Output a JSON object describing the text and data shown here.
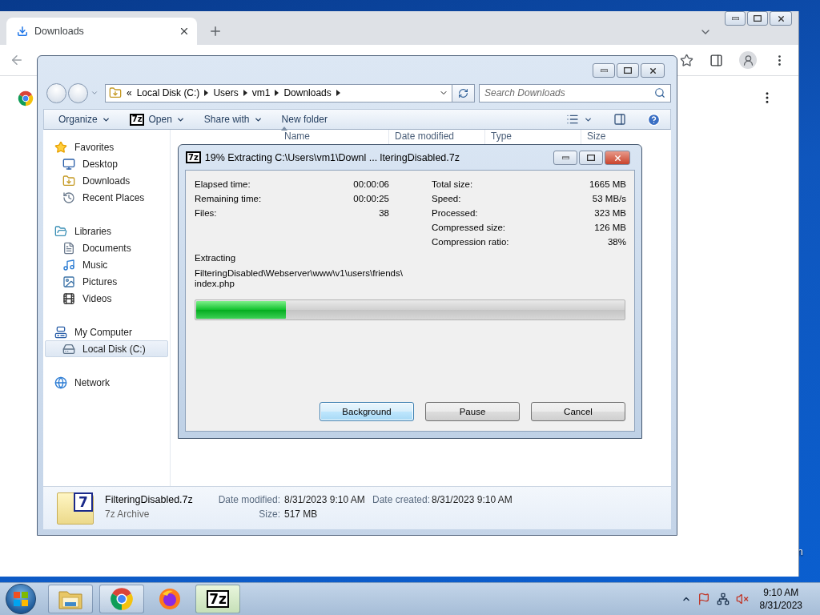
{
  "desktop": {
    "icon_label_fragment": "n"
  },
  "browser": {
    "tabs": [
      {
        "label": "Downloads",
        "selected": true
      }
    ]
  },
  "explorer": {
    "address": {
      "overflow": "«",
      "path": [
        "Local Disk (C:)",
        "Users",
        "vm1",
        "Downloads"
      ]
    },
    "search": {
      "placeholder": "Search Downloads"
    },
    "commands": [
      {
        "label": "Organize",
        "kind": "menu"
      },
      {
        "label": "Open",
        "kind": "app-menu",
        "badge": "7z"
      },
      {
        "label": "Share with",
        "kind": "menu"
      },
      {
        "label": "New folder",
        "kind": "plain"
      }
    ],
    "columns": [
      {
        "label": "Name",
        "sorted": true
      },
      {
        "label": "Date modified",
        "sorted": false
      },
      {
        "label": "Type",
        "sorted": false
      },
      {
        "label": "Size",
        "sorted": false
      }
    ],
    "navigation": [
      {
        "label": "Favorites",
        "kind": "favorites",
        "selected": false,
        "children": [
          {
            "label": "Desktop",
            "kind": "desktop",
            "selected": false
          },
          {
            "label": "Downloads",
            "kind": "downloads",
            "selected": false
          },
          {
            "label": "Recent Places",
            "kind": "recent",
            "selected": false
          }
        ]
      },
      {
        "label": "Libraries",
        "kind": "libraries",
        "selected": false,
        "children": [
          {
            "label": "Documents",
            "kind": "documents",
            "selected": false
          },
          {
            "label": "Music",
            "kind": "music",
            "selected": false
          },
          {
            "label": "Pictures",
            "kind": "pictures",
            "selected": false
          },
          {
            "label": "Videos",
            "kind": "videos",
            "selected": false
          }
        ]
      },
      {
        "label": "My Computer",
        "kind": "computer",
        "selected": false,
        "children": [
          {
            "label": "Local Disk (C:)",
            "kind": "drive",
            "selected": true
          }
        ]
      },
      {
        "label": "Network",
        "kind": "network",
        "selected": false
      }
    ],
    "details": {
      "badge": "7",
      "name": "FilteringDisabled.7z",
      "type": "7z Archive",
      "fields": [
        {
          "label": "Date modified:",
          "value": "8/31/2023 9:10 AM"
        },
        {
          "label": "Date created:",
          "value": "8/31/2023 9:10 AM"
        },
        {
          "label": "Size:",
          "value": "517 MB"
        }
      ]
    }
  },
  "dialog": {
    "badge": "7z",
    "title": "19% Extracting C:\\Users\\vm1\\Downl ... lteringDisabled.7z",
    "stats_left": [
      {
        "label": "Elapsed time:",
        "value": "00:00:06"
      },
      {
        "label": "Remaining time:",
        "value": "00:00:25"
      },
      {
        "label": "Files:",
        "value": "38"
      }
    ],
    "stats_right": [
      {
        "label": "Total size:",
        "value": "1665 MB"
      },
      {
        "label": "Speed:",
        "value": "53 MB/s"
      },
      {
        "label": "Processed:",
        "value": "323 MB"
      },
      {
        "label": "Compressed size:",
        "value": "126 MB"
      },
      {
        "label": "Compression ratio:",
        "value": "38%"
      }
    ],
    "status": "Extracting",
    "current_file": [
      "FilteringDisabled\\Webserver\\www\\v1\\users\\friends\\",
      "index.php"
    ],
    "progress": {
      "level": 0.21
    },
    "buttons": [
      {
        "label": "Background",
        "focused": true
      },
      {
        "label": "Pause",
        "focused": false
      },
      {
        "label": "Cancel",
        "focused": false
      }
    ]
  },
  "taskbar": {
    "items": [
      {
        "kind": "explorer",
        "running": true,
        "active": false
      },
      {
        "kind": "chrome",
        "running": true,
        "active": false
      },
      {
        "kind": "firefox",
        "running": false,
        "active": false
      },
      {
        "kind": "sevenzip",
        "badge": "7z",
        "running": true,
        "active": true
      }
    ],
    "clock": {
      "time": "9:10 AM",
      "date": "8/31/2023"
    }
  }
}
